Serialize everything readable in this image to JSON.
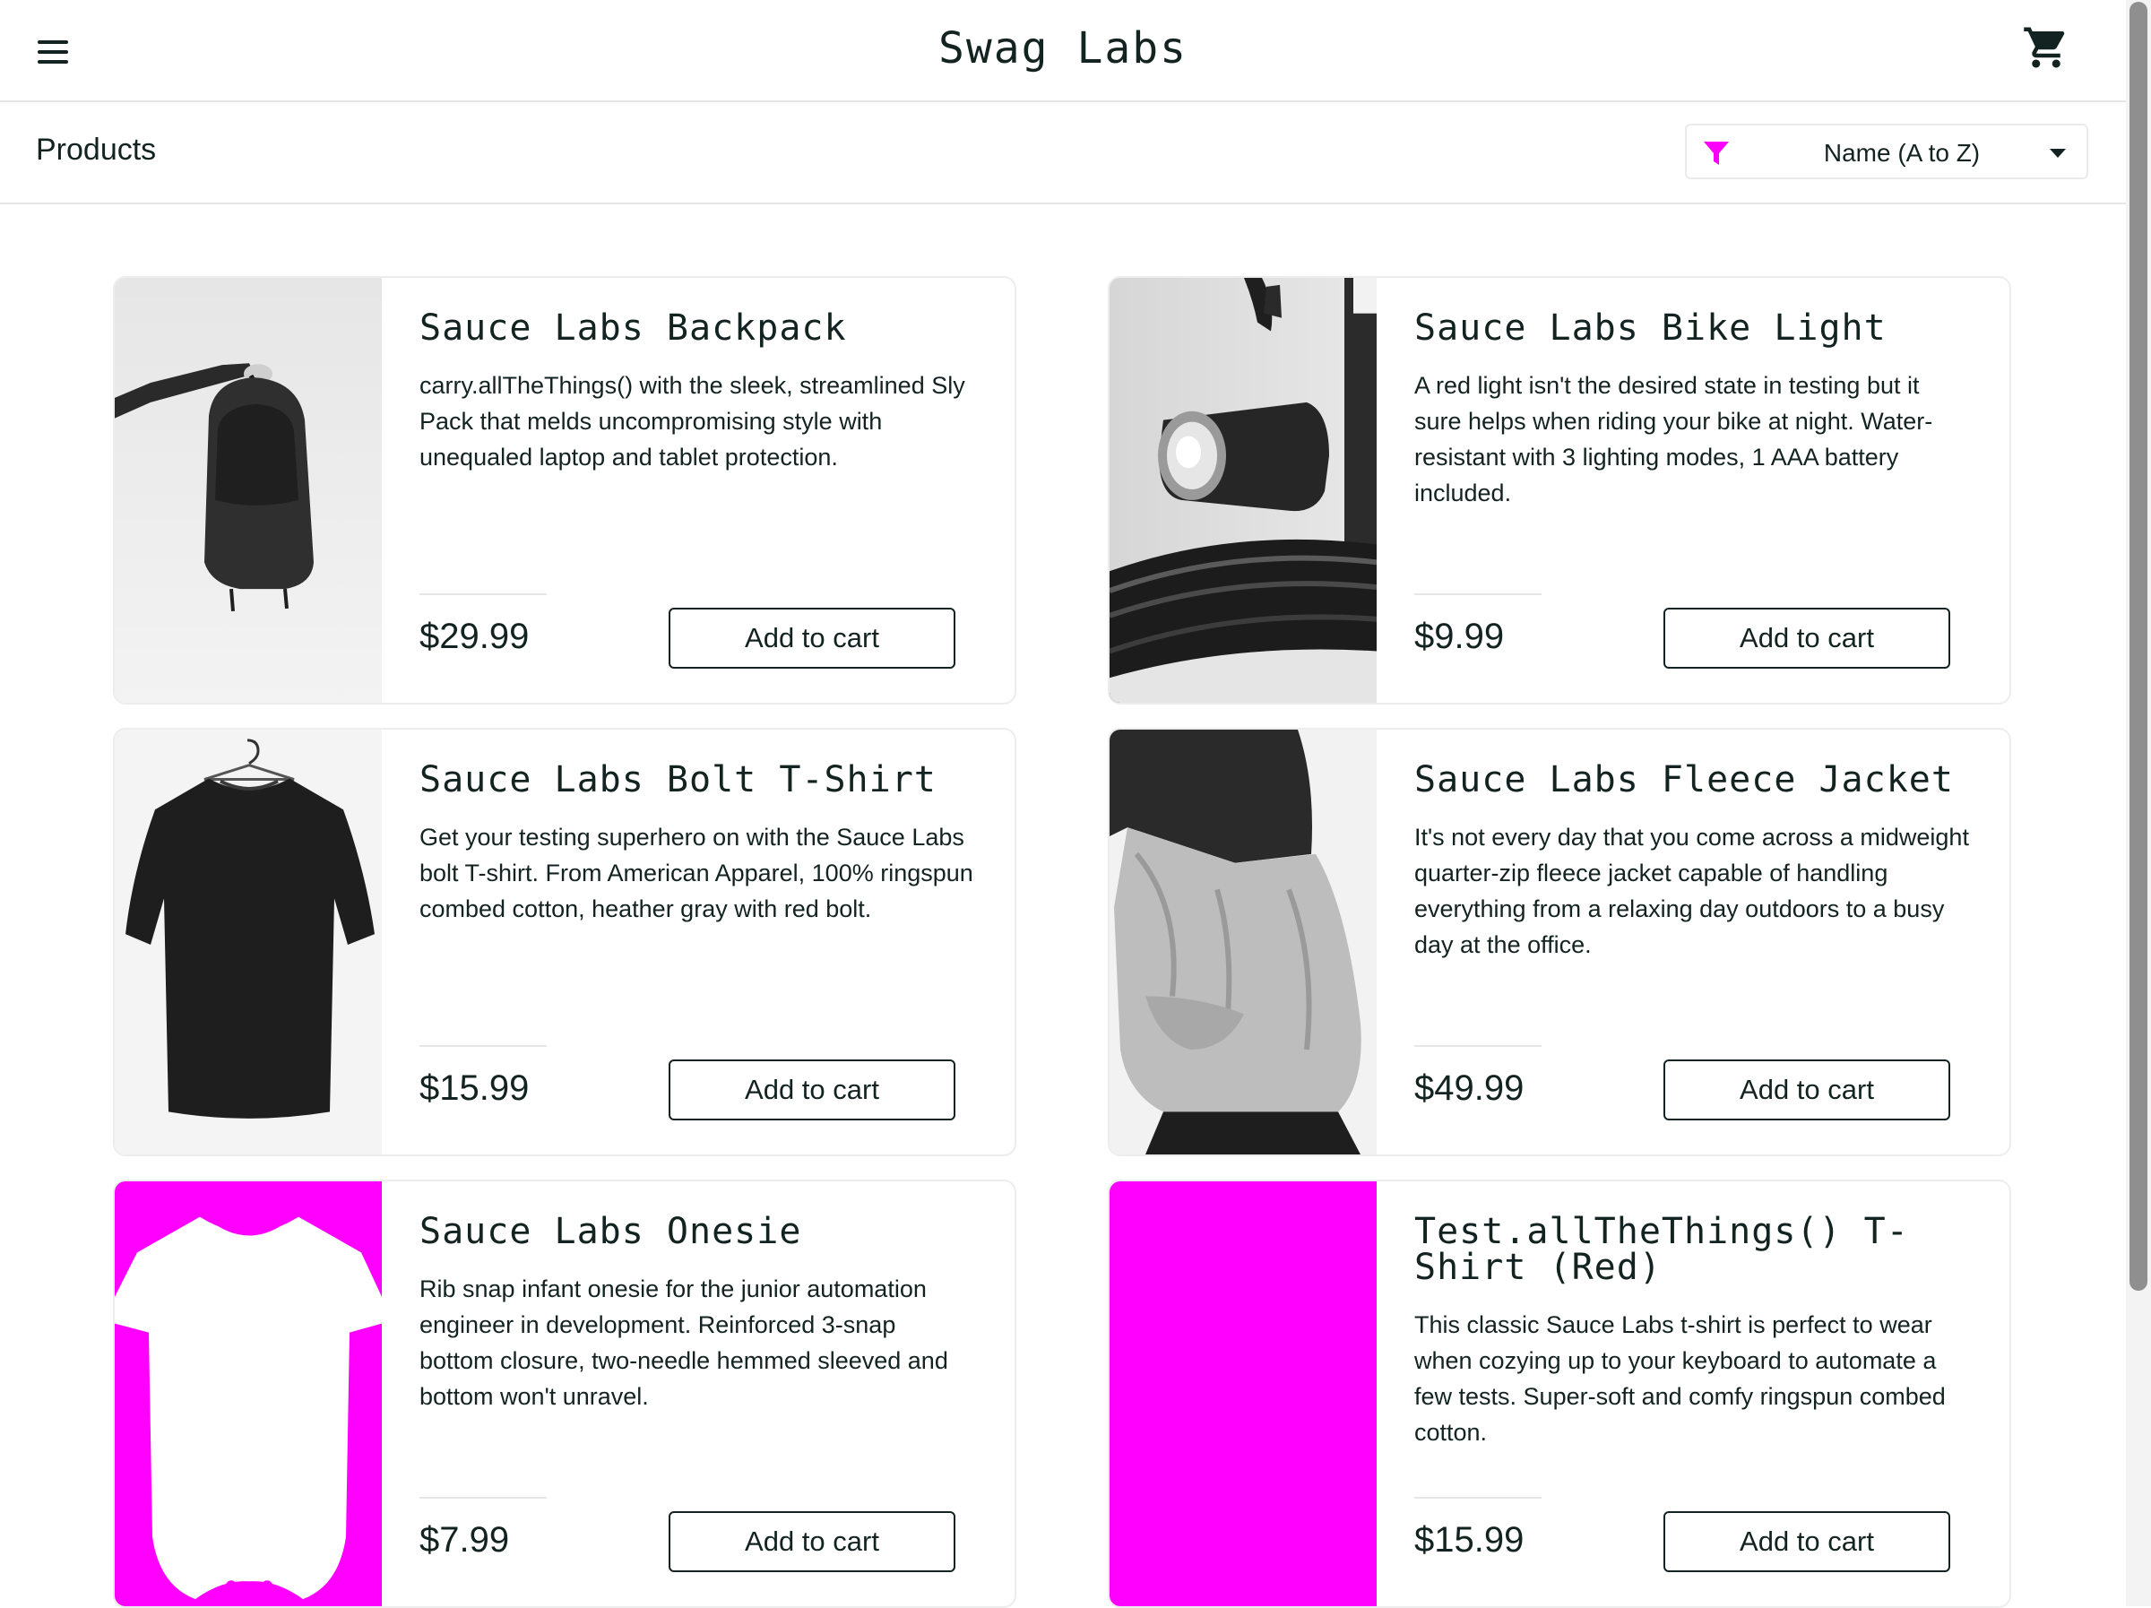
{
  "header": {
    "logo": "Swag Labs",
    "menu_icon": "hamburger-menu-icon",
    "cart_icon": "shopping-cart-icon"
  },
  "subheader": {
    "title": "Products",
    "sort": {
      "icon": "filter-funnel-icon",
      "selected": "Name (A to Z)",
      "icon_color": "#ff00ff"
    }
  },
  "inventory": {
    "items": [
      {
        "name": "Sauce Labs Backpack",
        "description": "carry.allTheThings() with the sleek, streamlined Sly Pack that melds uncompromising style with unequaled laptop and tablet protection.",
        "price": "$29.99",
        "button": "Add to cart"
      },
      {
        "name": "Sauce Labs Bike Light",
        "description": "A red light isn't the desired state in testing but it sure helps when riding your bike at night. Water-resistant with 3 lighting modes, 1 AAA battery included.",
        "price": "$9.99",
        "button": "Add to cart"
      },
      {
        "name": "Sauce Labs Bolt T-Shirt",
        "description": "Get your testing superhero on with the Sauce Labs bolt T-shirt. From American Apparel, 100% ringspun combed cotton, heather gray with red bolt.",
        "price": "$15.99",
        "button": "Add to cart"
      },
      {
        "name": "Sauce Labs Fleece Jacket",
        "description": "It's not every day that you come across a midweight quarter-zip fleece jacket capable of handling everything from a relaxing day outdoors to a busy day at the office.",
        "price": "$49.99",
        "button": "Add to cart"
      },
      {
        "name": "Sauce Labs Onesie",
        "description": "Rib snap infant onesie for the junior automation engineer in development. Reinforced 3-snap bottom closure, two-needle hemmed sleeved and bottom won't unravel.",
        "price": "$7.99",
        "button": "Add to cart"
      },
      {
        "name": "Test.allTheThings() T-Shirt (Red)",
        "description": "This classic Sauce Labs t-shirt is perfect to wear when cozying up to your keyboard to automate a few tests. Super-soft and comfy ringspun combed cotton.",
        "price": "$15.99",
        "button": "Add to cart"
      }
    ]
  },
  "colors": {
    "text": "#132322",
    "accent_magenta": "#ff00ff",
    "border": "#ededed"
  }
}
